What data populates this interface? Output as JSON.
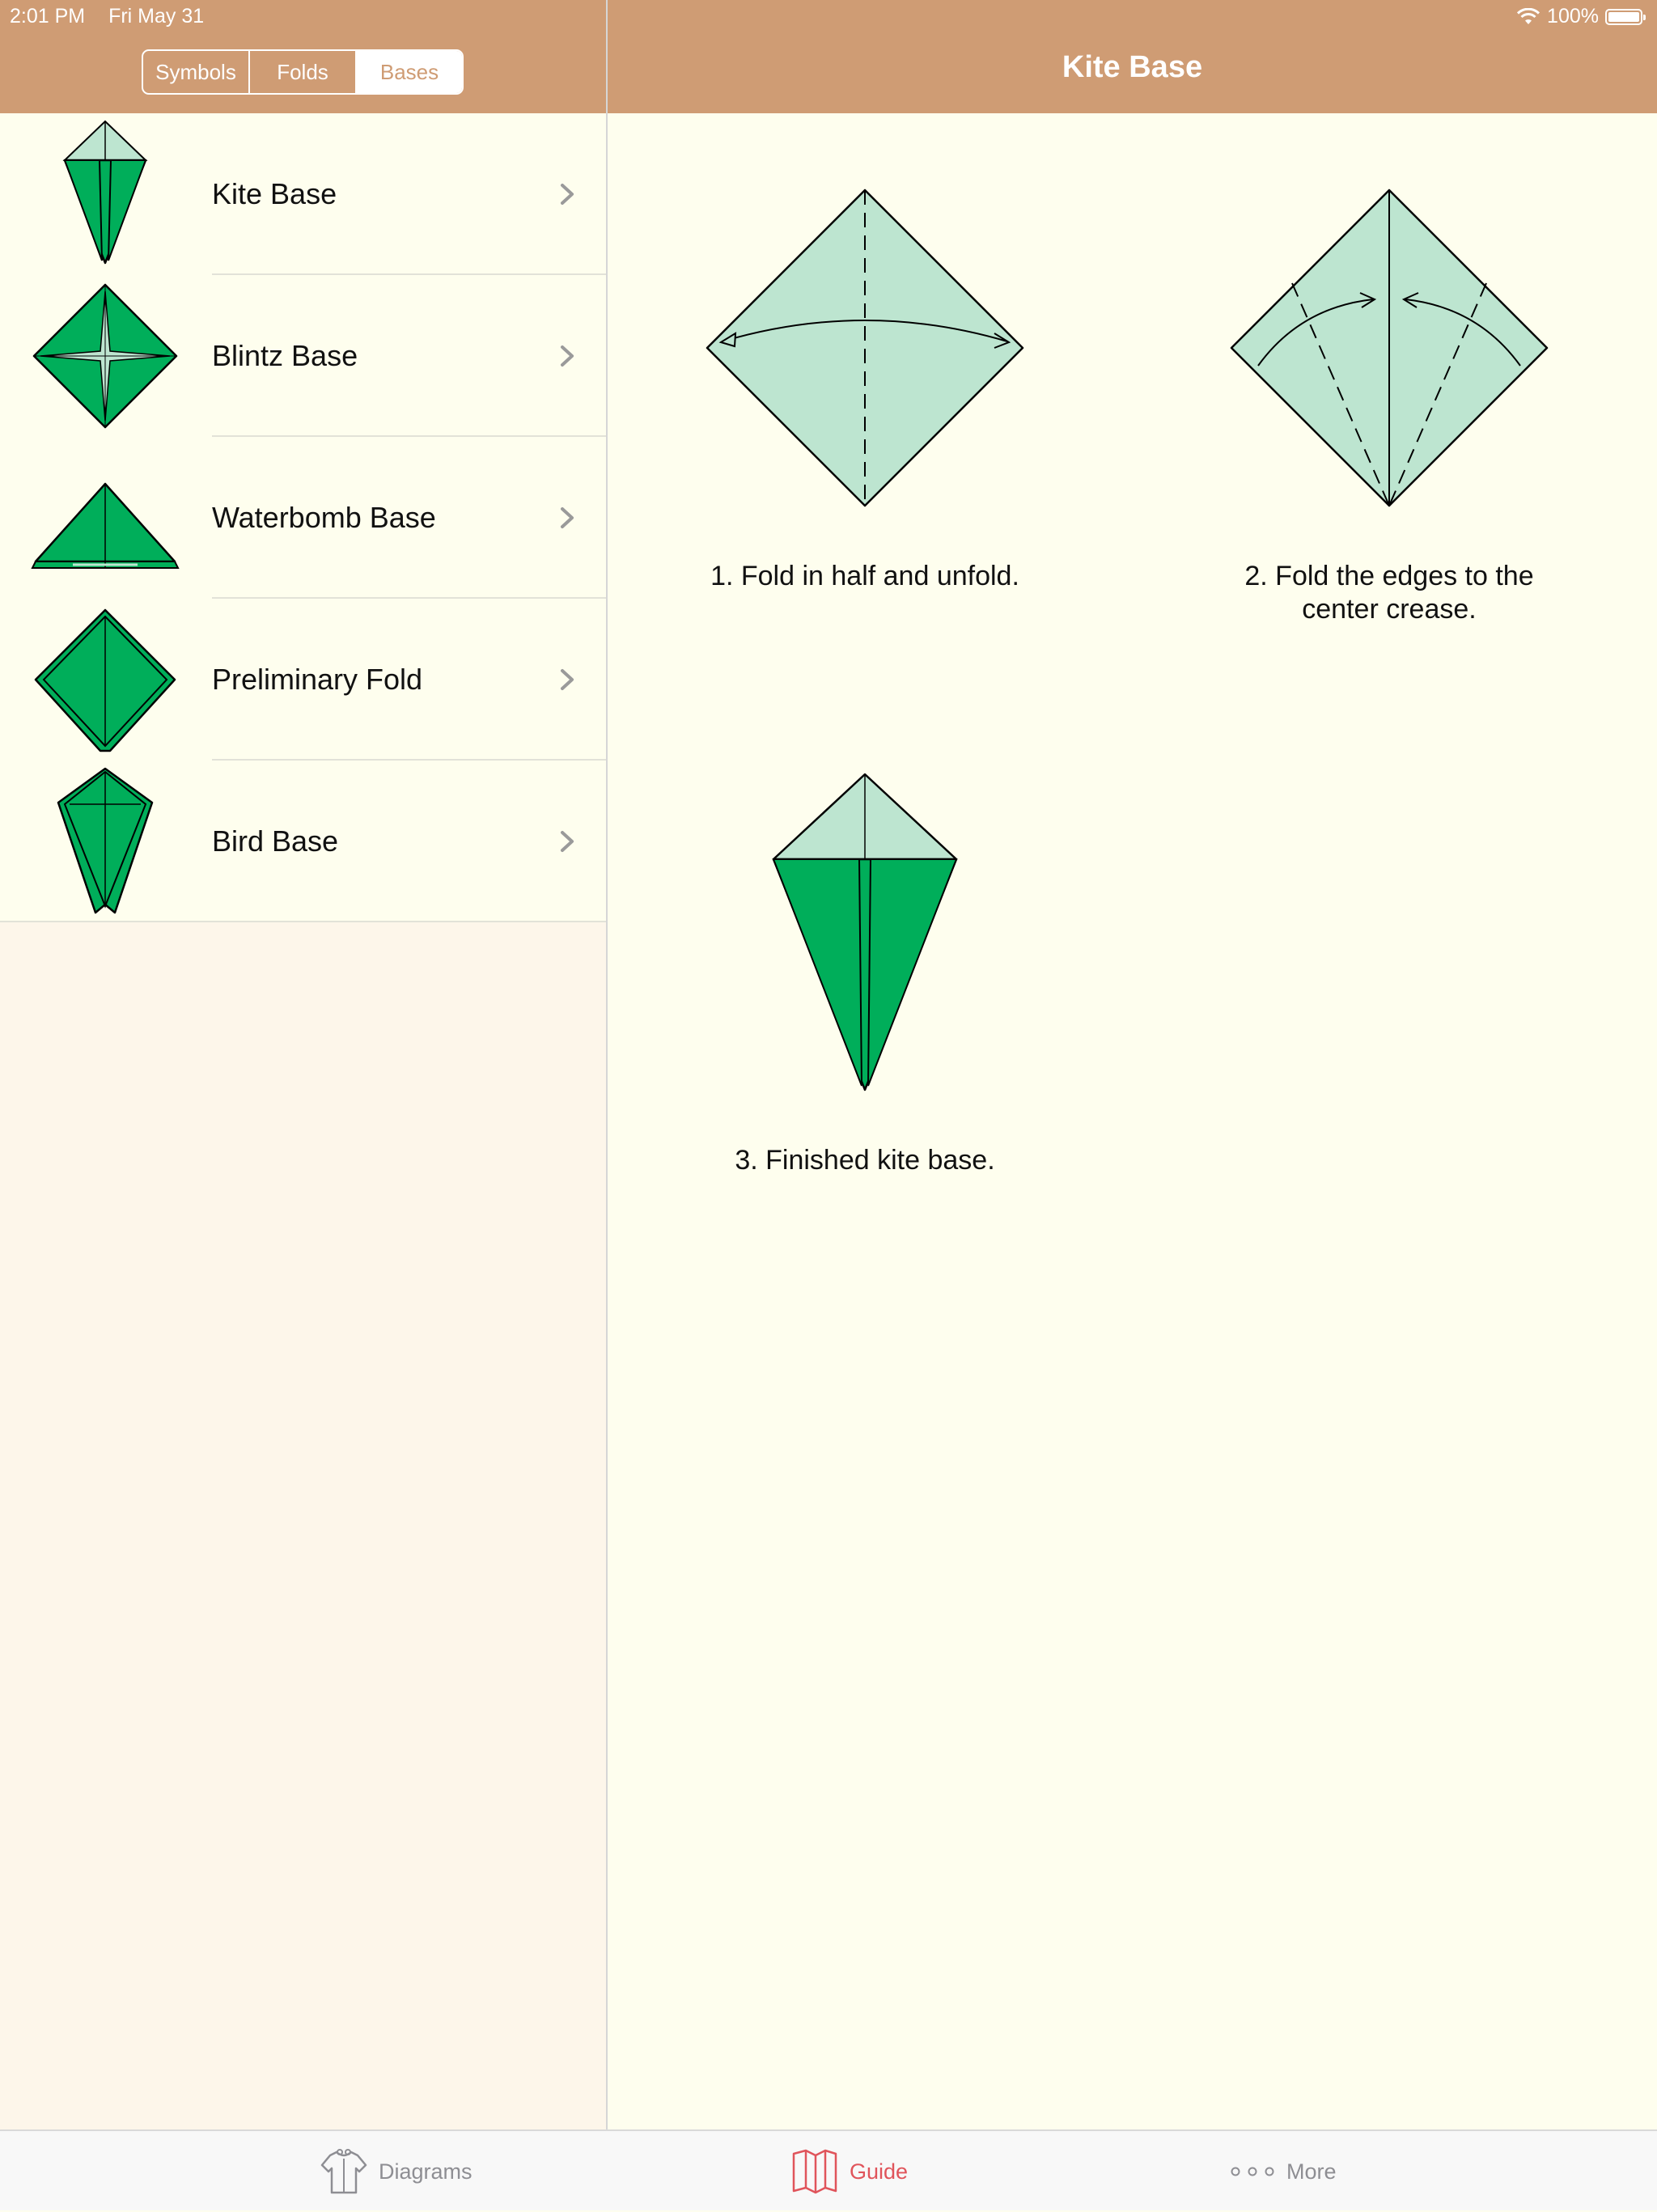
{
  "status_bar": {
    "time": "2:01 PM",
    "date": "Fri May 31",
    "battery": "100%"
  },
  "nav": {
    "segments": [
      {
        "label": "Symbols",
        "active": false
      },
      {
        "label": "Folds",
        "active": false
      },
      {
        "label": "Bases",
        "active": true
      }
    ],
    "title": "Kite Base"
  },
  "sidebar": {
    "items": [
      {
        "label": "Kite Base",
        "icon": "kite-base-icon"
      },
      {
        "label": "Blintz Base",
        "icon": "blintz-base-icon"
      },
      {
        "label": "Waterbomb Base",
        "icon": "waterbomb-base-icon"
      },
      {
        "label": "Preliminary Fold",
        "icon": "preliminary-fold-icon"
      },
      {
        "label": "Bird Base",
        "icon": "bird-base-icon"
      }
    ]
  },
  "steps": [
    {
      "caption": "1. Fold in half and unfold.",
      "diagram": "square-diamond-valley-fold-diagram"
    },
    {
      "caption": "2. Fold the edges to the\ncenter crease.",
      "diagram": "edges-to-center-diagram"
    },
    {
      "caption": "3. Finished kite base.",
      "diagram": "finished-kite-diagram"
    }
  ],
  "tabbar": {
    "tabs": [
      {
        "label": "Diagrams",
        "icon": "shirt-icon",
        "active": false
      },
      {
        "label": "Guide",
        "icon": "map-icon",
        "active": true
      },
      {
        "label": "More",
        "icon": "more-dots-icon",
        "active": false
      }
    ]
  },
  "colors": {
    "nav_background": "#cf9c74",
    "paper_light": "#bde5d0",
    "paper_dark": "#00ae5a",
    "accent_tab": "#e0545b"
  }
}
